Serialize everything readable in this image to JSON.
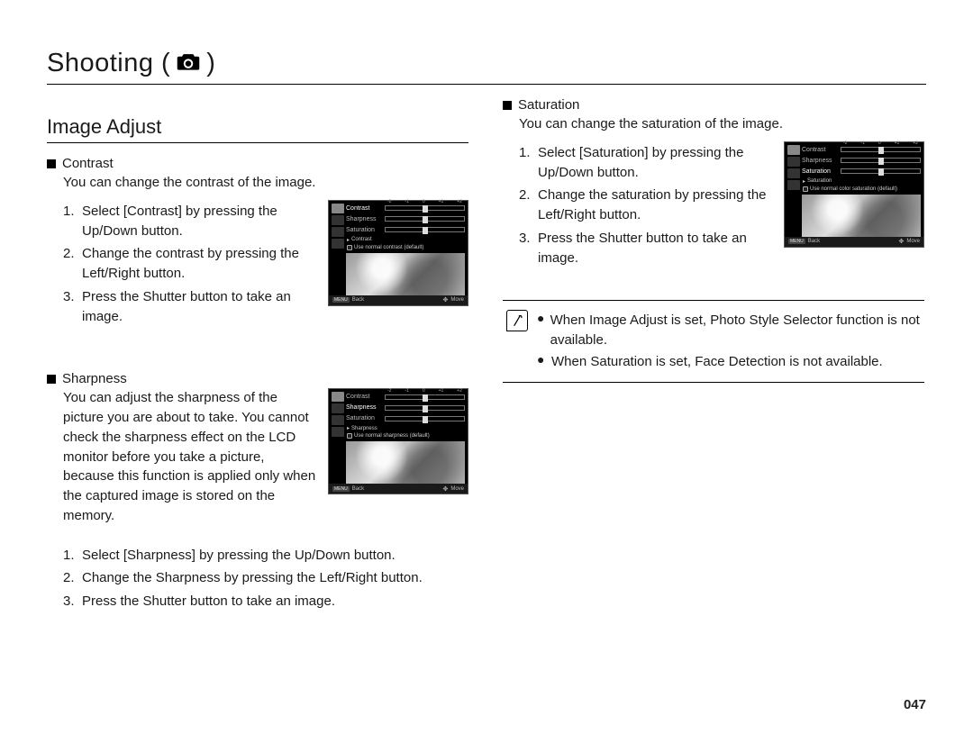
{
  "chapter": {
    "title_prefix": "Shooting (",
    "title_suffix": " )"
  },
  "section": {
    "title": "Image Adjust"
  },
  "contrast": {
    "label": "Contrast",
    "desc": "You can change the contrast of the image.",
    "steps": [
      "Select [Contrast] by pressing the Up/Down button.",
      "Change the contrast by pressing the Left/Right button.",
      "Press the Shutter button to take an image."
    ],
    "lcd": {
      "menu": [
        "Contrast",
        "Sharpness",
        "Saturation"
      ],
      "active_index": 0,
      "current": "Contrast",
      "hint": "Use normal contrast (default)",
      "ticks": [
        "-2",
        "-1",
        "0",
        "+1",
        "+2"
      ],
      "back": "Back",
      "move": "Move",
      "back_badge": "MENU"
    }
  },
  "sharpness": {
    "label": "Sharpness",
    "desc": "You can adjust the sharpness of the picture you are about to take. You cannot check the sharpness effect on the LCD monitor before you take a picture, because this function is applied only when the captured image is stored on the memory.",
    "steps": [
      "Select [Sharpness] by pressing the Up/Down button.",
      "Change the Sharpness by pressing the Left/Right button.",
      "Press the Shutter button to take an image."
    ],
    "lcd": {
      "menu": [
        "Contrast",
        "Sharpness",
        "Saturation"
      ],
      "active_index": 1,
      "current": "Sharpness",
      "hint": "Use normal sharpness (default)",
      "ticks": [
        "-2",
        "-1",
        "0",
        "+1",
        "+2"
      ],
      "back": "Back",
      "move": "Move",
      "back_badge": "MENU"
    }
  },
  "saturation": {
    "label": "Saturation",
    "desc": "You can change the saturation of the image.",
    "steps": [
      "Select [Saturation] by pressing the Up/Down button.",
      "Change the saturation by pressing the Left/Right button.",
      "Press the Shutter button to take an image."
    ],
    "lcd": {
      "menu": [
        "Contrast",
        "Sharpness",
        "Saturation"
      ],
      "active_index": 2,
      "current": "Saturation",
      "hint": "Use normal color saturation (default)",
      "ticks": [
        "-2",
        "-1",
        "0",
        "+1",
        "+2"
      ],
      "back": "Back",
      "move": "Move",
      "back_badge": "MENU"
    }
  },
  "notes": [
    "When Image Adjust  is set, Photo Style Selector function is not available.",
    "When Saturation is set, Face Detection is not available."
  ],
  "page_number": "047"
}
